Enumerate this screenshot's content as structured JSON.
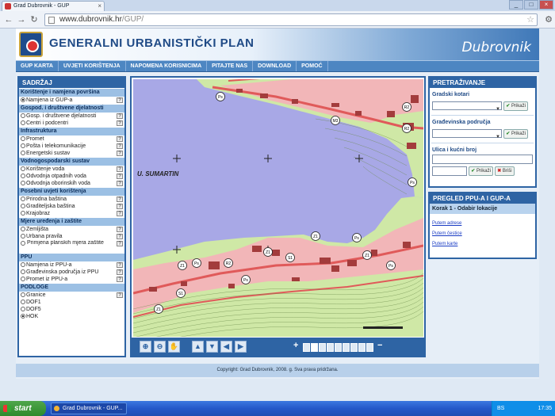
{
  "browser": {
    "tab_title": "Grad Dubrovnik - GUP",
    "tab_close": "×",
    "url_prefix": "www.dubrovnik.hr",
    "url_path": "/GUP/",
    "back_icon": "arrow-left",
    "forward_icon": "arrow-right",
    "reload_icon": "reload",
    "star_icon": "star",
    "wrench_icon": "wrench"
  },
  "header": {
    "title": "GENERALNI URBANISTIČKI PLAN",
    "city": "Dubrovnik"
  },
  "menu": [
    "GUP KARTA",
    "UVJETI KORIŠTENJA",
    "NAPOMENA KORISNICIMA",
    "PITAJTE NAS",
    "DOWNLOAD",
    "POMOĆ"
  ],
  "sadrzaj": {
    "title": "SADRŽAJ",
    "sections": [
      {
        "title": "Korištenje i namjena površina",
        "items": [
          {
            "label": "Namjena iz GUP-a",
            "checked": true
          }
        ]
      },
      {
        "title": "Gospod. i društvene djelatnosti",
        "items": [
          {
            "label": "Gosp. i društvene djelatnosti"
          },
          {
            "label": "Centri i podcentri"
          }
        ]
      },
      {
        "title": "Infrastruktura",
        "items": [
          {
            "label": "Promet"
          },
          {
            "label": "Pošta i telekomunikacije"
          },
          {
            "label": "Energetski sustav"
          }
        ]
      },
      {
        "title": "Vodnogospodarski sustav",
        "items": [
          {
            "label": "Korištenje voda"
          },
          {
            "label": "Odvodnja otpadnih voda"
          },
          {
            "label": "Odvodnja oborinskih voda"
          }
        ]
      },
      {
        "title": "Posebni uvjeti korištenja",
        "items": [
          {
            "label": "Prirodna baština"
          },
          {
            "label": "Graditeljska baština"
          },
          {
            "label": "Krajobraz"
          }
        ]
      },
      {
        "title": "Mjere uređenja i zaštite",
        "items": [
          {
            "label": "Zemljišta"
          },
          {
            "label": "Urbana pravila"
          },
          {
            "label": "Primjena planskih mjera zaštite",
            "two": true
          }
        ]
      },
      {
        "title": "PPU",
        "items": [
          {
            "label": "Namjena iz PPU-a"
          },
          {
            "label": "Građevinska područja iz PPU"
          },
          {
            "label": "Promet iz PPU-a"
          }
        ]
      },
      {
        "title": "PODLOGE",
        "items": [
          {
            "label": "Granice",
            "q": true
          },
          {
            "label": "DOF1",
            "q": false
          },
          {
            "label": "DOF5",
            "q": false
          },
          {
            "label": "HOK",
            "checked": true,
            "q": false
          }
        ]
      }
    ],
    "help": "?"
  },
  "map": {
    "place_label": "U. SUMARTIN",
    "zone_labels": [
      "Ps",
      "M3",
      "R2",
      "R2",
      "Ps",
      "Ps",
      "Z1",
      "Z1",
      "S1",
      "Z1",
      "R2",
      "Z1",
      "Ps",
      "Ps",
      "Ps",
      "Z1",
      "S1"
    ],
    "colors": {
      "sea": "#a8a8e6",
      "residential": "#f2b6b8",
      "green": "#cfe8a6",
      "building": "#a33c3c",
      "road": "#e05a5a"
    }
  },
  "map_controls": {
    "zoom_in_icon": "zoom-in-icon",
    "zoom_out_icon": "zoom-out-icon",
    "pan_icon": "hand-icon",
    "up": "▲",
    "down": "▼",
    "left": "◀",
    "right": "▶",
    "zoom_minus": "−",
    "zoom_plus": "+",
    "zoom_levels": 9,
    "zoom_active": 1
  },
  "pretrazivanje": {
    "title": "PRETRAŽIVANJE",
    "kotari_label": "Gradski kotari",
    "podrucja_label": "Građevinska područja",
    "ulica_label": "Ulica i kućni broj",
    "prikazi": "Prikaži",
    "brisi": "Briši"
  },
  "pregled": {
    "title": "PREGLED PPU-A I GUP-A",
    "step": "Korak 1 - Odabir lokacije",
    "links": [
      "Putem adrese",
      "Putem čestice",
      "Putem karte"
    ]
  },
  "footer": "Copyright: Grad Dubrovnik, 2008. g. Sva prava pridržana.",
  "taskbar": {
    "start": "start",
    "task": "Grad Dubrovnik - GUP...",
    "lang": "BS",
    "time": "17:35"
  }
}
